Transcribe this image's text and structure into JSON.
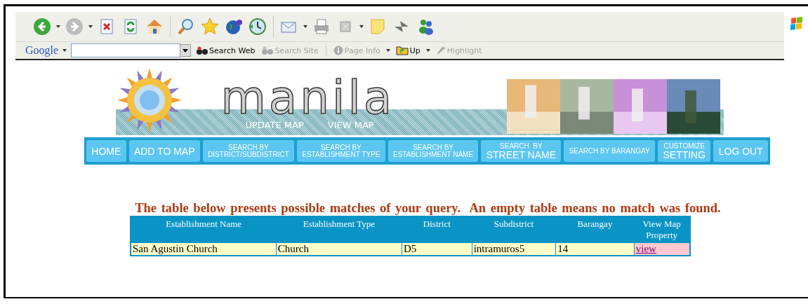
{
  "google_bar": {
    "logo": "Google",
    "buttons": [
      {
        "label": "Search Web",
        "disabled": false,
        "menu": false
      },
      {
        "label": "Search Site",
        "disabled": true,
        "menu": false
      },
      {
        "label": "Page Info",
        "disabled": true,
        "menu": true
      },
      {
        "label": "Up",
        "disabled": false,
        "menu": true
      },
      {
        "label": "Highlight",
        "disabled": true,
        "menu": false
      }
    ]
  },
  "banner": {
    "title": "manila",
    "links": [
      "UPDATE MAP",
      "VIEW MAP"
    ]
  },
  "nav": [
    {
      "lines": [
        "HOME"
      ]
    },
    {
      "lines": [
        "ADD TO MAP"
      ]
    },
    {
      "lines": [
        "SEARCH BY",
        "DISTRICT/SUBDISTRICT"
      ]
    },
    {
      "lines": [
        "SEARCH BY",
        "ESTABLISHMENT TYPE"
      ]
    },
    {
      "lines": [
        "SEARCH BY",
        "ESTABLISHMENT NAME"
      ]
    },
    {
      "lines": [
        "SEARCH  BY",
        "STREET NAME"
      ]
    },
    {
      "lines": [
        "SEARCH BY BARANGAY"
      ]
    },
    {
      "lines": [
        "CUSTOMIZE",
        "SETTING"
      ]
    },
    {
      "lines": [
        "LOG OUT"
      ]
    }
  ],
  "message": "The table below presents possible matches of your query.  An empty table means no match was found.",
  "table": {
    "columns": [
      "Establishment Name",
      "Establishment Type",
      "District",
      "Subdistrict",
      "Barangay",
      "View Map Property"
    ],
    "rows": [
      {
        "cells": [
          "San Agustin Church",
          "Church",
          "D5",
          "intramuros5",
          "14"
        ],
        "link": "view"
      }
    ]
  }
}
